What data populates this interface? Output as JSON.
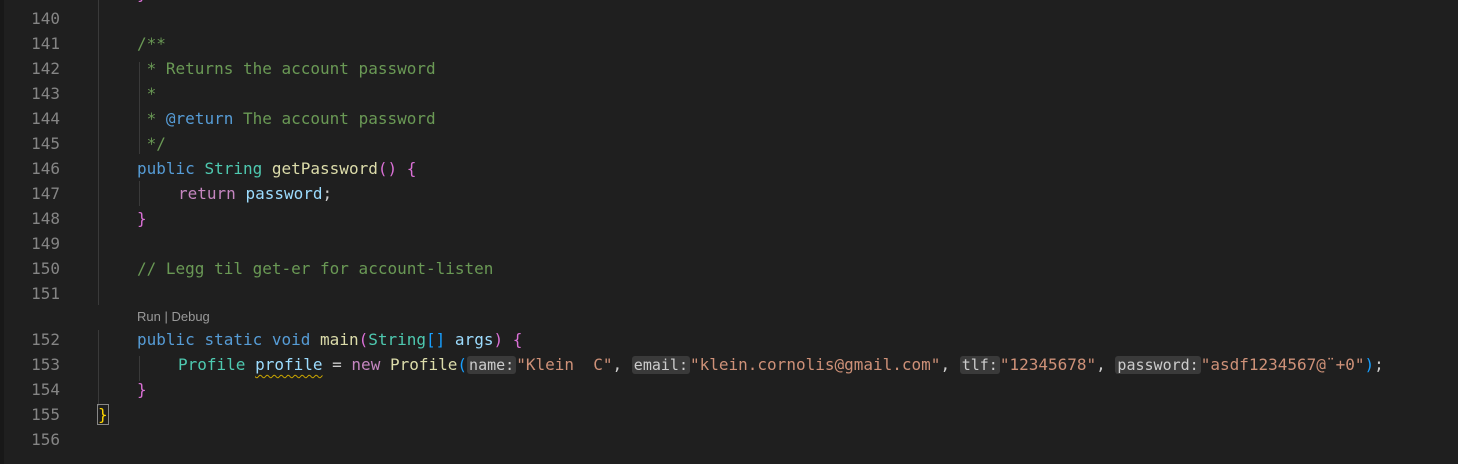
{
  "line_numbers": [
    "140",
    "141",
    "142",
    "143",
    "144",
    "145",
    "146",
    "147",
    "148",
    "149",
    "150",
    "151",
    "152",
    "153",
    "154",
    "155",
    "156"
  ],
  "code": {
    "l140_brace": "}",
    "l141": "/**",
    "l142": " * Returns the account password",
    "l143": " *",
    "l144_star": " * ",
    "l144_tag": "@return",
    "l144_rest": " The account password",
    "l145": " */",
    "l146_public": "public",
    "l146_type": "String",
    "l146_fn": "getPassword",
    "l146_parens": "()",
    "l146_brace": "{",
    "l147_return": "return",
    "l147_var": "password",
    "l147_semi": ";",
    "l148_brace": "}",
    "l150": "// Legg til get-er for account-listen",
    "l152_public": "public",
    "l152_static": "static",
    "l152_void": "void",
    "l152_fn": "main",
    "l152_paren_open": "(",
    "l152_type": "String",
    "l152_arr": "[]",
    "l152_args": "args",
    "l152_paren_close": ")",
    "l152_brace": "{",
    "l153_type": "Profile",
    "l153_var": "profile",
    "l153_eq": " = ",
    "l153_new": "new",
    "l153_ctor": "Profile",
    "l153_paren_open": "(",
    "l153_hint_name": "name:",
    "l153_val_name": "\"Klein  C\"",
    "l153_hint_email": "email:",
    "l153_val_email": "\"klein.cornolis@gmail.com\"",
    "l153_hint_tlf": "tlf:",
    "l153_val_tlf": "\"12345678\"",
    "l153_hint_password": "password:",
    "l153_val_password": "\"asdf1234567@¨+0\"",
    "l153_paren_close": ")",
    "l153_semi": ";",
    "comma": ", ",
    "l154_brace": "}",
    "l155_brace": "}"
  },
  "codelens": {
    "run": "Run",
    "separator": " | ",
    "debug": "Debug"
  },
  "colors": {
    "background": "#1f1f1f",
    "keyword": "#569cd6",
    "control_keyword": "#c586c0",
    "type": "#4ec9b0",
    "function": "#dcdcaa",
    "variable": "#9cdcfe",
    "string": "#ce9178",
    "comment": "#6a9955"
  }
}
